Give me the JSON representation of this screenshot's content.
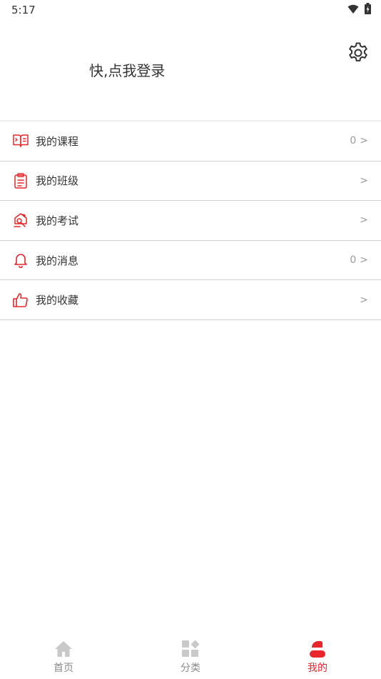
{
  "status_bar": {
    "time": "5:17",
    "icons": [
      "wifi-icon",
      "battery-icon"
    ]
  },
  "header": {
    "login_prompt": "快,点我登录",
    "settings_icon": "gear-icon"
  },
  "menu": [
    {
      "icon": "book-icon",
      "label": "我的课程",
      "count": "0",
      "arrow": ">"
    },
    {
      "icon": "clipboard-icon",
      "label": "我的班级",
      "count": "",
      "arrow": ">"
    },
    {
      "icon": "exam-icon",
      "label": "我的考试",
      "count": "",
      "arrow": ">"
    },
    {
      "icon": "bell-icon",
      "label": "我的消息",
      "count": "0",
      "arrow": ">"
    },
    {
      "icon": "thumbs-up-icon",
      "label": "我的收藏",
      "count": "",
      "arrow": ">"
    }
  ],
  "bottom_nav": [
    {
      "icon": "home-icon",
      "label": "首页",
      "active": false
    },
    {
      "icon": "category-icon",
      "label": "分类",
      "active": false
    },
    {
      "icon": "profile-icon",
      "label": "我的",
      "active": true
    }
  ],
  "colors": {
    "accent": "#e8262b",
    "text": "#333333",
    "muted": "#9a9a9a",
    "divider": "#cfcfcf"
  }
}
